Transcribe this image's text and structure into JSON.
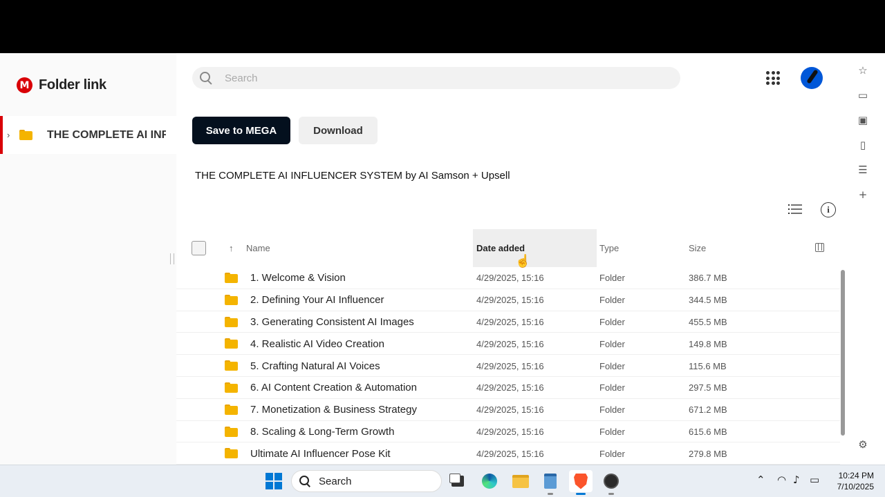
{
  "sidebar": {
    "logo_text": "Folder link",
    "logo_glyph": "M",
    "tree_item_label": "THE COMPLETE AI INFLUENCER SYSTEM by AI Samson + Upsell"
  },
  "search": {
    "placeholder": "Search"
  },
  "actions": {
    "save_label": "Save to MEGA",
    "download_label": "Download"
  },
  "folder_title": "THE COMPLETE AI INFLUENCER SYSTEM by AI Samson + Upsell",
  "table": {
    "headers": {
      "name": "Name",
      "date": "Date added",
      "type": "Type",
      "size": "Size"
    },
    "rows": [
      {
        "name": "1. Welcome & Vision",
        "date": "4/29/2025, 15:16",
        "type": "Folder",
        "size": "386.7 MB"
      },
      {
        "name": "2. Defining Your AI Influencer",
        "date": "4/29/2025, 15:16",
        "type": "Folder",
        "size": "344.5 MB"
      },
      {
        "name": "3. Generating Consistent AI Images",
        "date": "4/29/2025, 15:16",
        "type": "Folder",
        "size": "455.5 MB"
      },
      {
        "name": "4. Realistic AI Video Creation",
        "date": "4/29/2025, 15:16",
        "type": "Folder",
        "size": "149.8 MB"
      },
      {
        "name": "5. Crafting Natural AI Voices",
        "date": "4/29/2025, 15:16",
        "type": "Folder",
        "size": "115.6 MB"
      },
      {
        "name": "6. AI Content Creation & Automation",
        "date": "4/29/2025, 15:16",
        "type": "Folder",
        "size": "297.5 MB"
      },
      {
        "name": "7. Monetization & Business Strategy",
        "date": "4/29/2025, 15:16",
        "type": "Folder",
        "size": "671.2 MB"
      },
      {
        "name": "8. Scaling & Long-Term Growth",
        "date": "4/29/2025, 15:16",
        "type": "Folder",
        "size": "615.6 MB"
      },
      {
        "name": "Ultimate AI Influencer Pose Kit",
        "date": "4/29/2025, 15:16",
        "type": "Folder",
        "size": "279.8 MB"
      }
    ]
  },
  "taskbar": {
    "search_label": "Search",
    "time": "10:24 PM",
    "date": "7/10/2025"
  },
  "colors": {
    "brand": "#d90007",
    "save_button": "#04101e",
    "folder": "#f4b400",
    "windows_accent": "#0078d4"
  }
}
